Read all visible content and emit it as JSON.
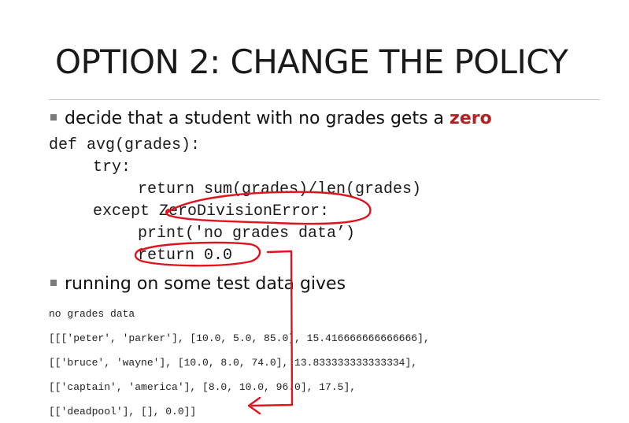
{
  "slide": {
    "title": "OPTION 2: CHANGE THE POLICY",
    "bullet1_text": "decide that a student with no grades gets a ",
    "bullet1_emphasis": "zero",
    "code_lines": [
      "def avg(grades):",
      "try:",
      "return sum(grades)/len(grades)",
      "except ZeroDivisionError:",
      "print('no grades data’)",
      "return 0.0"
    ],
    "bullet2_text": "running on some test data gives",
    "output_lines": [
      "no grades data",
      "[[['peter', 'parker'], [10.0, 5.0, 85.0], 15.416666666666666],",
      "[['bruce', 'wayne'], [10.0, 8.0, 74.0], 13.833333333333334],",
      "[['captain', 'america'], [8.0, 10.0, 96.0], 17.5],",
      "[['deadpool'], [], 0.0]]"
    ],
    "annotation_color": "#e0141e",
    "emphasis_color": "#b22222"
  }
}
